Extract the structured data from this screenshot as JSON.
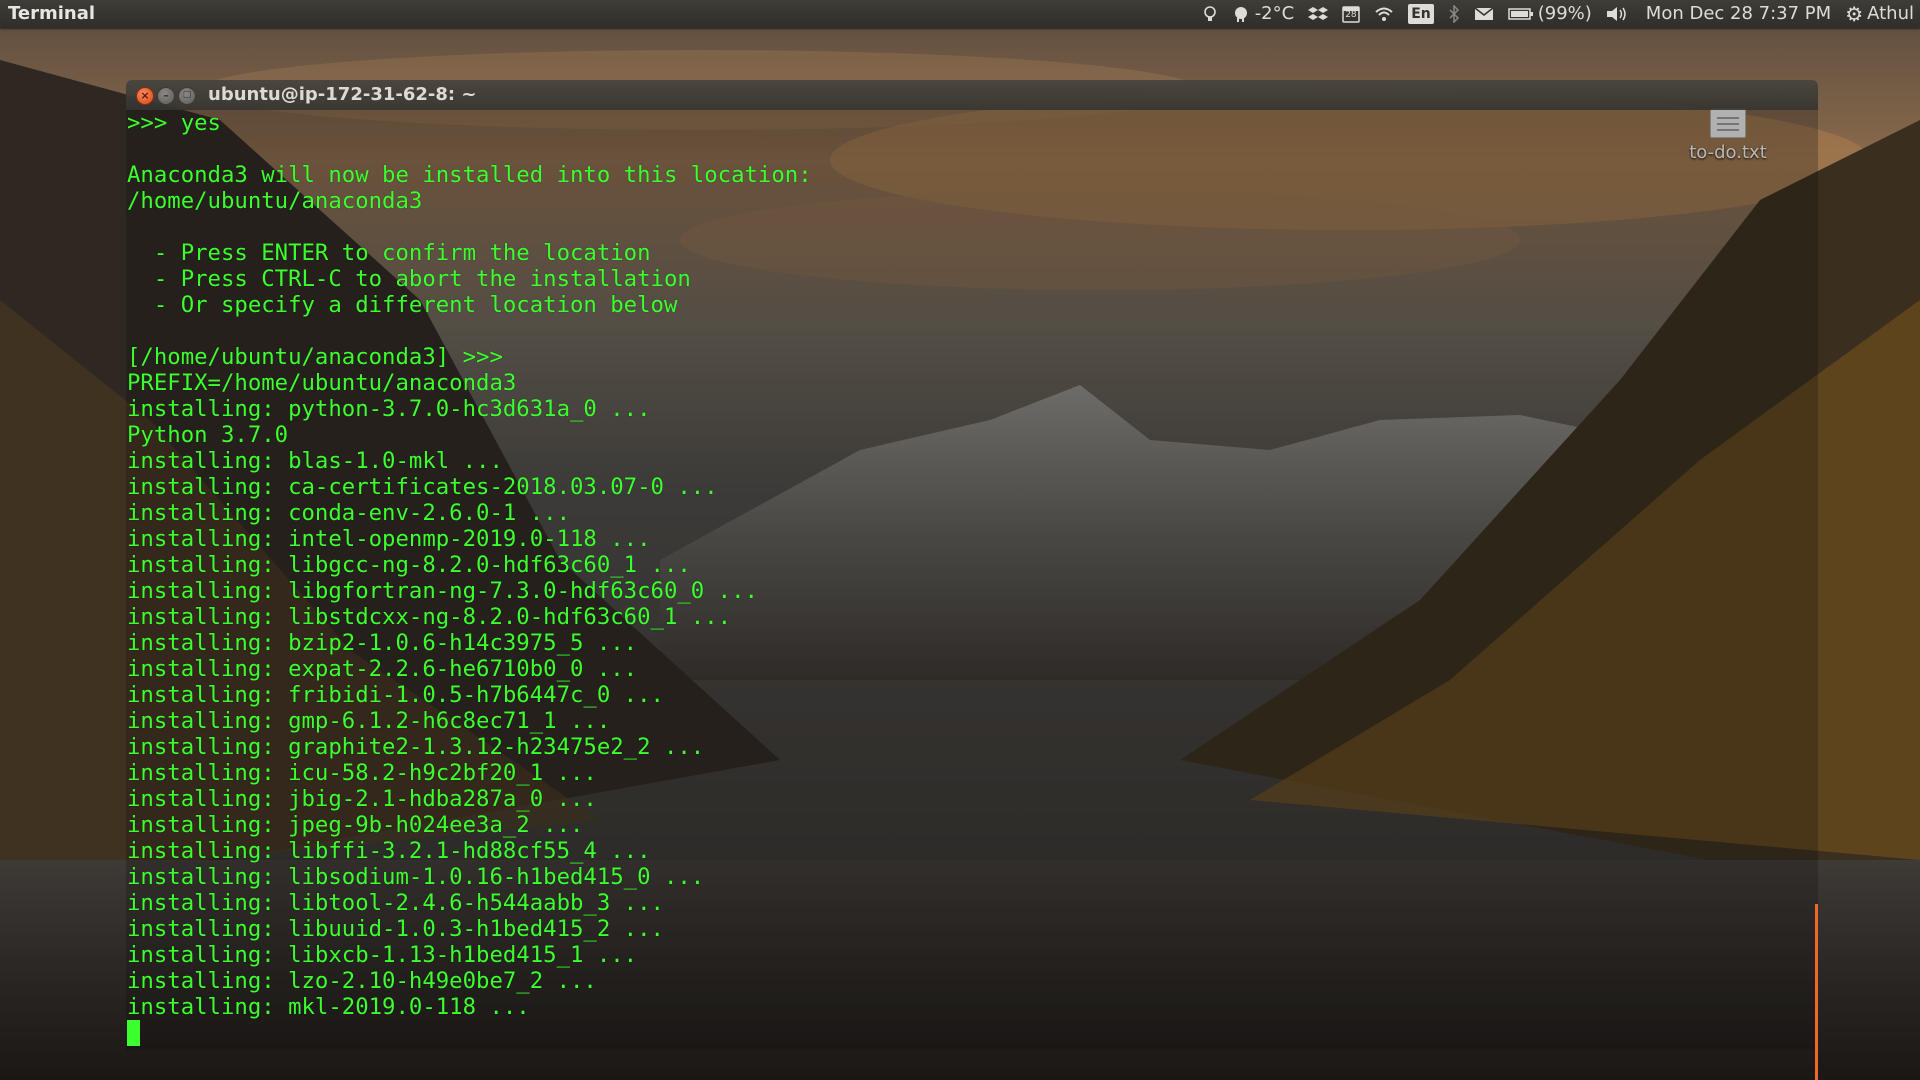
{
  "top_panel": {
    "app_name": "Terminal",
    "weather": "-2°C",
    "calendar_day": "28",
    "keyboard_layout": "En",
    "battery": "(99%)",
    "clock": "Mon Dec 28  7:37 PM",
    "user": "Athul"
  },
  "desktop": {
    "file_label": "to-do.txt"
  },
  "terminal": {
    "title": "ubuntu@ip-172-31-62-8: ~",
    "lines": [
      ">>> yes",
      "",
      "Anaconda3 will now be installed into this location:",
      "/home/ubuntu/anaconda3",
      "",
      "  - Press ENTER to confirm the location",
      "  - Press CTRL-C to abort the installation",
      "  - Or specify a different location below",
      "",
      "[/home/ubuntu/anaconda3] >>>",
      "PREFIX=/home/ubuntu/anaconda3",
      "installing: python-3.7.0-hc3d631a_0 ...",
      "Python 3.7.0",
      "installing: blas-1.0-mkl ...",
      "installing: ca-certificates-2018.03.07-0 ...",
      "installing: conda-env-2.6.0-1 ...",
      "installing: intel-openmp-2019.0-118 ...",
      "installing: libgcc-ng-8.2.0-hdf63c60_1 ...",
      "installing: libgfortran-ng-7.3.0-hdf63c60_0 ...",
      "installing: libstdcxx-ng-8.2.0-hdf63c60_1 ...",
      "installing: bzip2-1.0.6-h14c3975_5 ...",
      "installing: expat-2.2.6-he6710b0_0 ...",
      "installing: fribidi-1.0.5-h7b6447c_0 ...",
      "installing: gmp-6.1.2-h6c8ec71_1 ...",
      "installing: graphite2-1.3.12-h23475e2_2 ...",
      "installing: icu-58.2-h9c2bf20_1 ...",
      "installing: jbig-2.1-hdba287a_0 ...",
      "installing: jpeg-9b-h024ee3a_2 ...",
      "installing: libffi-3.2.1-hd88cf55_4 ...",
      "installing: libsodium-1.0.16-h1bed415_0 ...",
      "installing: libtool-2.4.6-h544aabb_3 ...",
      "installing: libuuid-1.0.3-h1bed415_2 ...",
      "installing: libxcb-1.13-h1bed415_1 ...",
      "installing: lzo-2.10-h49e0be7_2 ...",
      "installing: mkl-2019.0-118 ..."
    ]
  },
  "icons": [
    "lightbulb-icon",
    "weather-icon",
    "dropbox-icon",
    "calendar-icon",
    "wifi-icon",
    "keyboard-icon",
    "bluetooth-icon",
    "mail-icon",
    "battery-icon",
    "volume-icon",
    "gear-icon",
    "close-icon",
    "minimize-icon",
    "maximize-icon",
    "text-file-icon"
  ],
  "colors": {
    "terminal_text": "#3cff2e",
    "scrollbar": "#e96a2a",
    "close_button": "#e5531f"
  }
}
